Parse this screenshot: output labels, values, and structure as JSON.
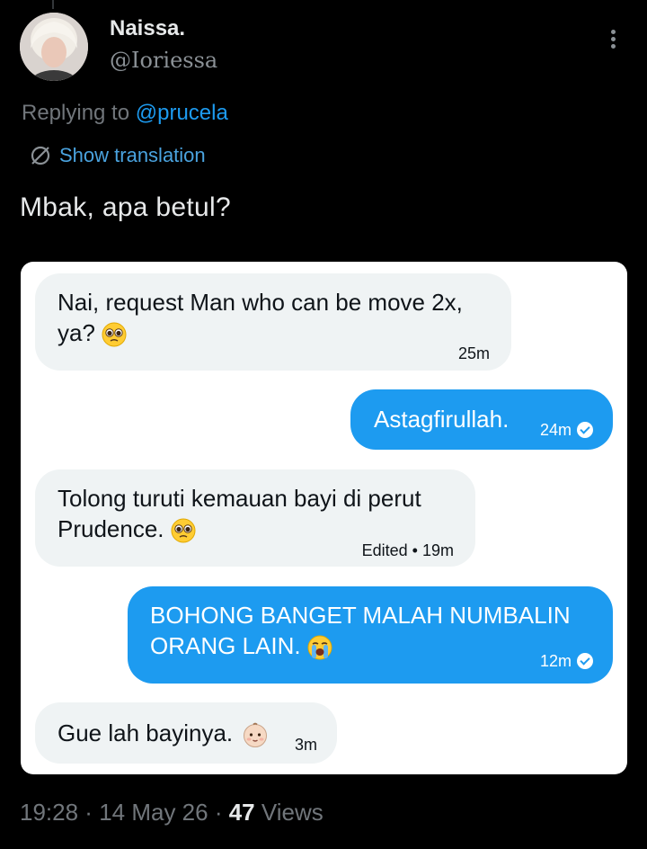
{
  "author": {
    "display_name": "Naissa.",
    "handle": "@Ioriessa"
  },
  "reply": {
    "prefix": "Replying to ",
    "mention": "@prucela"
  },
  "translation_label": "Show translation",
  "tweet_text": "Mbak, apa betul?",
  "icons": {
    "avatar": "profile-photo",
    "more": "more-vertical-icon",
    "translate": "globe-slash-icon",
    "read_receipt": "check-circle-icon",
    "pleading_emoji": "pleading-face-emoji",
    "crying_emoji": "loudly-crying-face-emoji",
    "baby_emoji": "baby-face-emoji"
  },
  "colors": {
    "background": "#000000",
    "accent": "#1d9bf0",
    "incoming_bubble": "#eff3f4",
    "muted_text": "#71767b"
  },
  "messages": [
    {
      "direction": "incoming",
      "line1": "Nai, request Man who can be move 2x,",
      "line2": "ya?",
      "emoji": "pleading-face-emoji",
      "time": "25m"
    },
    {
      "direction": "outgoing",
      "line1": "Astagfirullah.",
      "time": "24m",
      "read": true
    },
    {
      "direction": "incoming",
      "line1": "Tolong turuti kemauan bayi di perut",
      "line2": "Prudence.",
      "emoji": "pleading-face-emoji",
      "time": "Edited • 19m"
    },
    {
      "direction": "outgoing",
      "line1": "BOHONG BANGET MALAH NUMBALIN",
      "line2": "ORANG LAIN.",
      "emoji": "loudly-crying-face-emoji",
      "time": "12m",
      "read": true
    },
    {
      "direction": "incoming",
      "line1": "Gue lah bayinya.",
      "emoji": "baby-face-emoji",
      "time": "3m"
    }
  ],
  "meta": {
    "time": "19:28",
    "sep1": " · ",
    "date": "14 May 26",
    "sep2": " · ",
    "views_count": "47",
    "views_label": " Views"
  }
}
